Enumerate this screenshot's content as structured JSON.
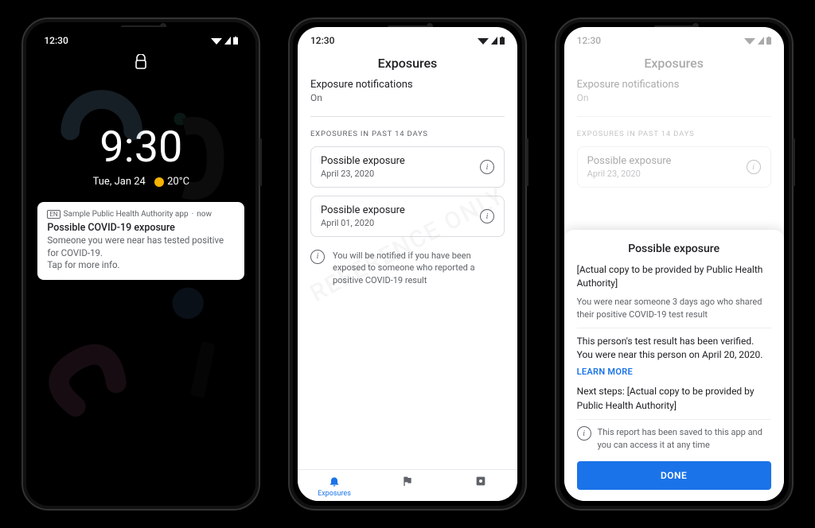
{
  "status_time": "12:30",
  "phone1": {
    "clock": "9:30",
    "date": "Tue, Jan 24",
    "temp": "20°C",
    "notification": {
      "icon_badge": "EN",
      "app": "Sample Public Health Authority app",
      "when": "now",
      "title": "Possible COVID-19 exposure",
      "body1": "Someone you were near has tested positive for COVID-19.",
      "body2": "Tap for more info."
    }
  },
  "phone2": {
    "header": "Exposures",
    "notif_title": "Exposure notifications",
    "notif_state": "On",
    "section_label": "EXPOSURES IN PAST 14 DAYS",
    "cards": [
      {
        "title": "Possible exposure",
        "date": "April 23, 2020"
      },
      {
        "title": "Possible exposure",
        "date": "April 01, 2020"
      }
    ],
    "footnote": "You will be notified if you have been exposed to someone who reported a positive COVID-19 result",
    "watermark": "REFERENCE ONLY",
    "nav": {
      "exposures": "Exposures"
    }
  },
  "phone3": {
    "header": "Exposures",
    "notif_title": "Exposure notifications",
    "notif_state": "On",
    "section_label": "EXPOSURES IN PAST 14 DAYS",
    "card": {
      "title": "Possible exposure",
      "date": "April 23, 2020"
    },
    "sheet": {
      "title": "Possible exposure",
      "copy_placeholder": "[Actual copy to be provided by Public Health Authority]",
      "body1": "You were near someone 3 days ago who shared their positive COVID-19 test result",
      "body2": "This person's test result has been verified. You were near this person on April 20, 2020.",
      "learn": "LEARN MORE",
      "next_steps": "Next steps: [Actual copy to be provided by Public Health Authority]",
      "saved": "This report has been saved to this app and you can access it at any time",
      "done": "DONE"
    }
  }
}
